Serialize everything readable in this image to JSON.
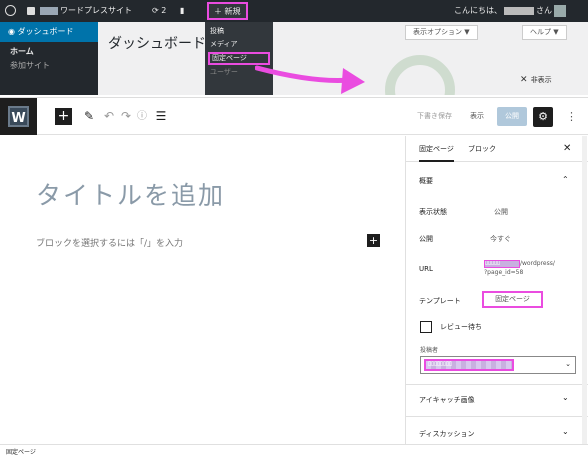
{
  "admin_bar": {
    "site_name": "ワードプレスサイト",
    "updates_count": "2",
    "new_label": "＋ 新規",
    "greeting": "こんにちは、",
    "greeting_suffix": "さん"
  },
  "admin_sidebar": {
    "dashboard": "ダッシュボード",
    "home": "ホーム",
    "my_sites": "参加サイト"
  },
  "admin_main": {
    "title": "ダッシュボード",
    "screen_options": "表示オプション ▼",
    "help": "ヘルプ ▼",
    "hide": "非表示"
  },
  "new_dropdown": [
    "投稿",
    "メディア",
    "固定ページ",
    "ユーザー"
  ],
  "toolbar": {
    "save_draft": "下書き保存",
    "preview": "表示",
    "publish": "公開"
  },
  "editor": {
    "title_placeholder": "タイトルを追加",
    "block_hint": "ブロックを選択するには「/」を入力"
  },
  "sidebar": {
    "tab_page": "固定ページ",
    "tab_block": "ブロック",
    "summary_heading": "概要",
    "visibility_label": "表示状態",
    "visibility_value": "公開",
    "publish_label": "公開",
    "publish_value": "今すぐ",
    "url_label": "URL",
    "url_masked": "ﾛﾛﾛﾛﾛ",
    "url_value_1": "/wordpress/",
    "url_value_2": "?page_id=58",
    "template_label": "テンプレート",
    "template_value": "固定ページ",
    "review_label": "レビュー待ち",
    "author_label": "投稿者",
    "author_masked": "ﾛﾛﾛﾛﾛﾛﾛﾛ",
    "featured_image": "アイキャッチ画像",
    "discussion": "ディスカッション"
  },
  "footer": {
    "breadcrumb": "固定ページ"
  },
  "colors": {
    "highlight": "#ea4ce0",
    "admin_dark": "#23282d",
    "admin_blue": "#0073aa"
  }
}
